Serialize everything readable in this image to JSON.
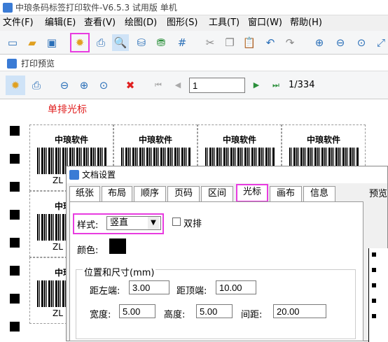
{
  "window": {
    "title": "中琅条码标签打印软件-V6.5.3 试用版 单机"
  },
  "menu": [
    "文件(F)",
    "编辑(E)",
    "查看(V)",
    "绘图(D)",
    "图形(S)",
    "工具(T)",
    "窗口(W)",
    "帮助(H)"
  ],
  "preview": {
    "title": "打印预览",
    "page_input": "1",
    "page_count": "1/334",
    "heading": "单排光标",
    "label_title": "中琅软件",
    "label_code": "ZL"
  },
  "dialog": {
    "title": "文档设置",
    "tabs": [
      "纸张",
      "布局",
      "顺序",
      "页码",
      "区间",
      "光标",
      "画布",
      "信息"
    ],
    "active_tab": "光标",
    "style_label": "样式:",
    "style_value": "竖直",
    "double_label": "双排",
    "color_label": "颜色:",
    "color_value": "#000000",
    "group_title": "位置和尺寸(mm)",
    "left_label": "距左端:",
    "left_value": "3.00",
    "top_label": "距顶端:",
    "top_value": "10.00",
    "width_label": "宽度:",
    "width_value": "5.00",
    "height_label": "高度:",
    "height_value": "5.00",
    "gap_label": "间距:",
    "gap_value": "20.00",
    "preview_label": "预览"
  }
}
